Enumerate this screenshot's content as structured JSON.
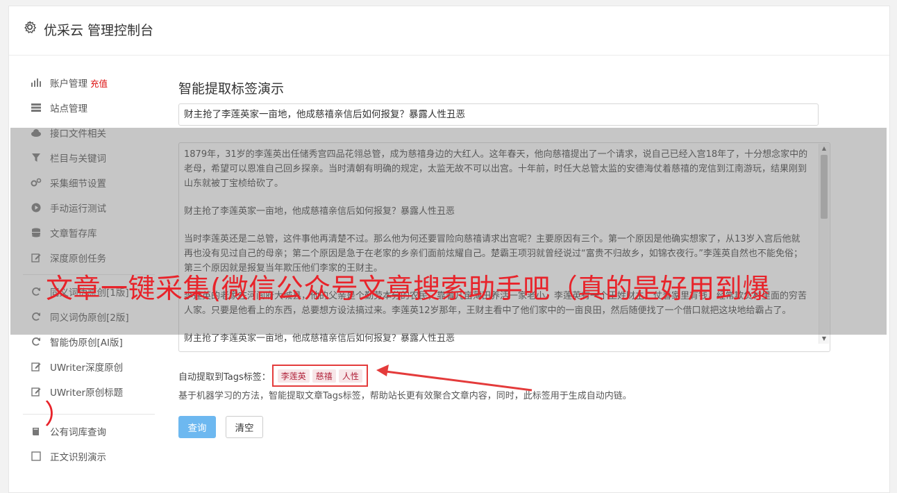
{
  "header": {
    "title": "优采云 管理控制台",
    "icon": "gear-icon"
  },
  "sidebar": {
    "items": [
      {
        "label": "账户管理",
        "badge": "充值",
        "icon": "bar-chart-icon"
      },
      {
        "label": "站点管理",
        "icon": "server-icon"
      },
      {
        "label": "接口文件相关",
        "icon": "cloud-upload-icon"
      },
      {
        "label": "栏目与关键词",
        "icon": "filter-icon"
      },
      {
        "label": "采集细节设置",
        "icon": "gears-icon"
      },
      {
        "label": "手动运行测试",
        "icon": "play-circle-icon"
      },
      {
        "label": "文章暂存库",
        "icon": "database-icon"
      },
      {
        "label": "深度原创任务",
        "icon": "edit-icon"
      },
      {
        "label": "同义词伪原创[1版]",
        "icon": "refresh-icon"
      },
      {
        "label": "同义词伪原创[2版]",
        "icon": "refresh-icon"
      },
      {
        "label": "智能伪原创[AI版]",
        "icon": "refresh-icon"
      },
      {
        "label": "UWriter深度原创",
        "icon": "edit-icon"
      },
      {
        "label": "UWriter原创标题",
        "icon": "edit-icon"
      },
      {
        "label": "公有词库查询",
        "icon": "book-icon"
      },
      {
        "label": "正文识别演示",
        "icon": "square-icon"
      }
    ]
  },
  "main": {
    "heading": "智能提取标签演示",
    "title_value": "财主抢了李莲英家一亩地，他成慈禧亲信后如何报复？暴露人性丑恶",
    "content_paragraphs": [
      "1879年，31岁的李莲英出任储秀宫四品花翎总管，成为慈禧身边的大红人。这年春天，他向慈禧提出了一个请求，说自己已经入宫18年了，十分想念家中的老母，希望可以恩准自己回乡探亲。当时清朝有明确的规定，太监无故不可以出宫。十年前，时任大总管太监的安德海仗着慈禧的宠信到江南游玩，结果刚到山东就被丁宝桢给砍了。",
      "财主抢了李莲英家一亩地，他成慈禧亲信后如何报复？暴露人性丑恶",
      "当时李莲英还是二总管，这件事他再清楚不过。那么他为何还要冒险向慈禧请求出宫呢？主要原因有三个。第一个原因是他确实想家了，从13岁入宫后他就再也没有见过自己的母亲；第二个原因是急于在老家的乡亲们面前炫耀自己。楚霸王项羽就曾经说过“富贵不归故乡，如锦衣夜行。”李莲英自然也不能免俗；第三个原因就是报复当年欺压他们李家的王财主。",
      "李莲英的老家在河间府大城县，他的父亲是个勤劳本分的农民，靠着几亩薄田养活一家老小。李莲英有一个王姓财主，仗着家里有钱，经常欺负村里面的穷苦人家。只要是他看上的东西，总要想方设法搞过来。李莲英12岁那年，王财主看中了他们家中的一亩良田，然后随便找了一个借口就把这块地给霸占了。",
      "财主抢了李莲英家一亩地，他成慈禧亲信后如何报复？暴露人性丑恶"
    ],
    "tags_label": "自动提取到Tags标签：",
    "tags": [
      "李莲英",
      "慈禧",
      "人性"
    ],
    "description": "基于机器学习的方法，智能提取文章Tags标签，帮助站长更有效聚合文章内容，同时，此标签用于生成自动内链。",
    "query_label": "查询",
    "clear_label": "清空"
  },
  "overlay": {
    "text": "文章一键采集(微信公众号文章搜索助手吧（真的是好用到爆",
    "tail": "）",
    "accent": "#e8232a"
  }
}
